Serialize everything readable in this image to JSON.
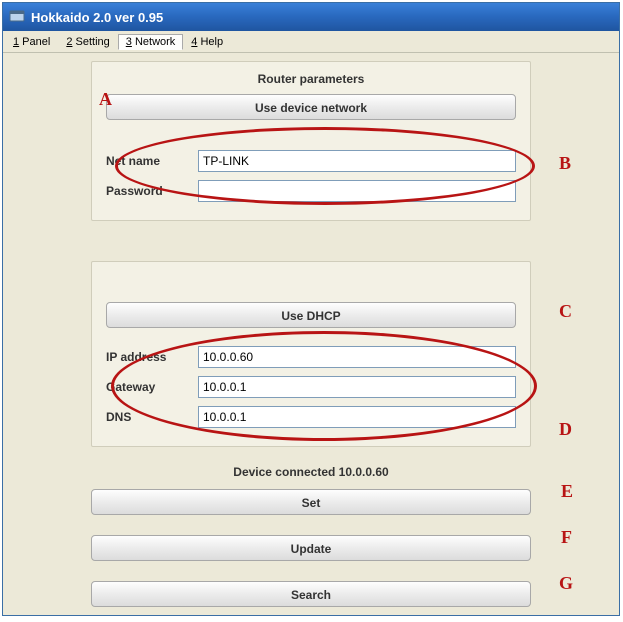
{
  "window": {
    "title": "Hokkaido 2.0 ver 0.95"
  },
  "menubar": {
    "items": [
      {
        "mnem": "1",
        "label": " Panel"
      },
      {
        "mnem": "2",
        "label": " Setting"
      },
      {
        "mnem": "3",
        "label": " Network"
      },
      {
        "mnem": "4",
        "label": " Help"
      }
    ]
  },
  "router_panel": {
    "title": "Router parameters",
    "use_device_btn": "Use device network",
    "net_name_label": "Net name",
    "net_name_value": "TP-LINK",
    "password_label": "Password",
    "password_value": ""
  },
  "dhcp_panel": {
    "use_dhcp_btn": "Use DHCP",
    "ip_label": "IP address",
    "ip_value": "10.0.0.60",
    "gateway_label": "Gateway",
    "gateway_value": "10.0.0.1",
    "dns_label": "DNS",
    "dns_value": "10.0.0.1"
  },
  "status": "Device connected 10.0.0.60",
  "buttons": {
    "set": "Set",
    "update": "Update",
    "search": "Search"
  },
  "annotations": {
    "A": "A",
    "B": "B",
    "C": "C",
    "D": "D",
    "E": "E",
    "F": "F",
    "G": "G"
  }
}
